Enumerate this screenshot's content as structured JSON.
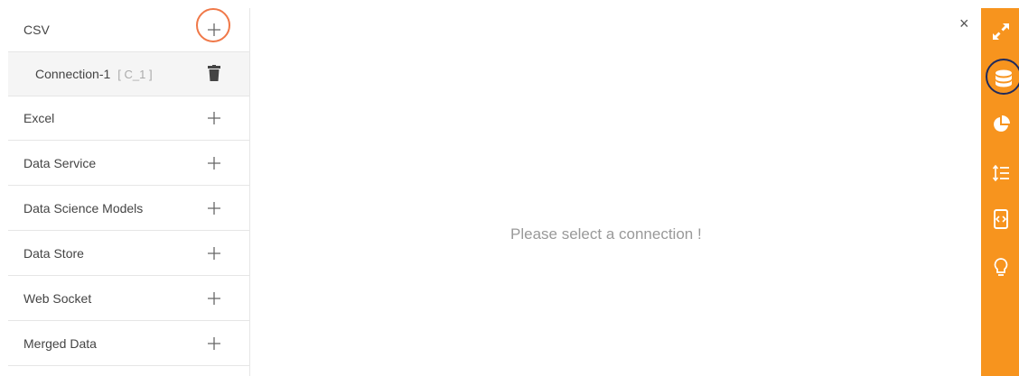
{
  "sidebar": {
    "items": [
      {
        "label": "CSV"
      },
      {
        "label": "Connection-1",
        "tag": "[ C_1 ]"
      },
      {
        "label": "Excel"
      },
      {
        "label": "Data Service"
      },
      {
        "label": "Data Science Models"
      },
      {
        "label": "Data Store"
      },
      {
        "label": "Web Socket"
      },
      {
        "label": "Merged Data"
      }
    ],
    "add_icon": "plus-icon",
    "delete_icon": "trash-icon"
  },
  "main": {
    "message": "Please select a connection !"
  },
  "close": {
    "label": "×"
  },
  "rail": {
    "color": "#f7941e",
    "icons": [
      "expand-icon",
      "database-icon",
      "pie-chart-icon",
      "sort-list-icon",
      "code-icon",
      "lightbulb-icon"
    ],
    "active": "database-icon"
  },
  "highlight_color": "#f07848"
}
